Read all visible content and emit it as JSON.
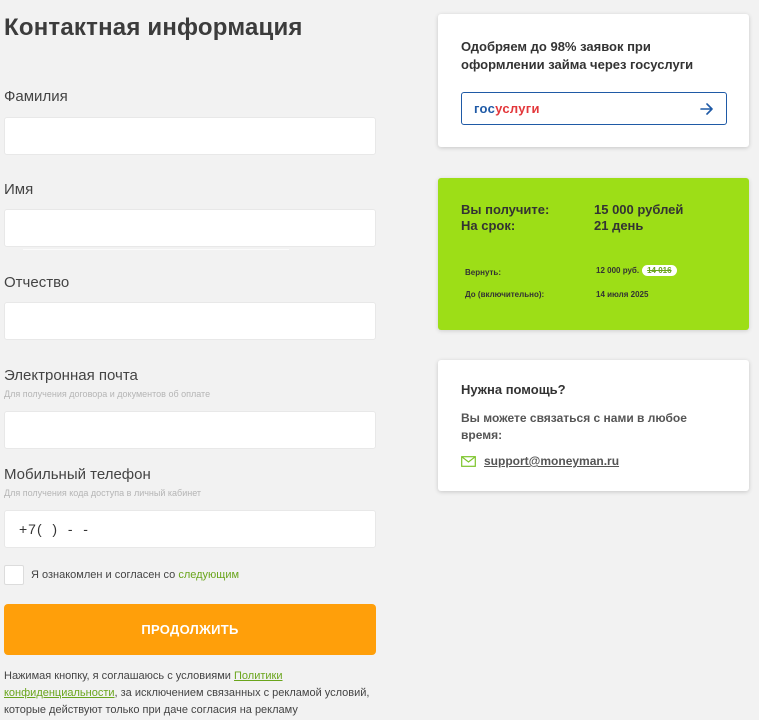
{
  "page": {
    "title": "Контактная информация"
  },
  "form": {
    "last_name": {
      "label": "Фамилия",
      "value": ""
    },
    "first_name": {
      "label": "Имя",
      "value": ""
    },
    "middle_name": {
      "label": "Отчество",
      "value": ""
    },
    "email": {
      "label": "Электронная почта",
      "hint": "Для получения договора и документов об оплате",
      "value": ""
    },
    "phone": {
      "label": "Мобильный телефон",
      "hint": "Для получения кода доступа в личный кабинет",
      "value": "+7(  )  -  -"
    },
    "agree": {
      "text": "Я ознакомлен и согласен со",
      "link": "следующим",
      "checked": false
    },
    "submit_label": "ПРОДОЛЖИТЬ",
    "consent": {
      "before": "Нажимая кнопку, я соглашаюсь с условиями ",
      "link": "Политики конфиденциальности",
      "after": ", за исключением связанных с рекламой условий, которые действуют только при даче согласия на рекламу"
    }
  },
  "gosuslugi": {
    "title": "Одобряем до 98% заявок при оформлении займа через госуслуги",
    "logo_part1": "гос",
    "logo_part2": "услуги",
    "icon": "arrow-right-icon"
  },
  "offer": {
    "receive_label": "Вы получите:",
    "receive_value": "15 000 рублей",
    "term_label": "На срок:",
    "term_value": "21 день",
    "return_label": "Вернуть:",
    "return_value": "12 000 руб.",
    "return_old": "14 016",
    "until_label": "До (включительно):",
    "until_value": "14 июля 2025",
    "color": "#9dde17"
  },
  "help": {
    "title": "Нужна помощь?",
    "text": "Вы можете связаться с нами в любое время:",
    "email": "support@moneyman.ru",
    "icon": "mail-icon"
  },
  "colors": {
    "accent_orange": "#ff9f0a",
    "accent_green": "#6aa51c",
    "gos_blue": "#1f5aa6",
    "gos_red": "#e3373b"
  }
}
